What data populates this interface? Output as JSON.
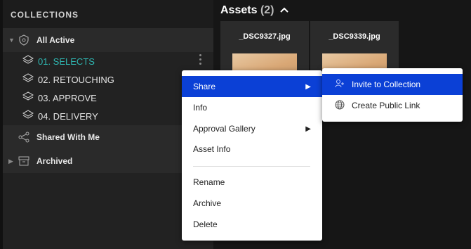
{
  "sidebar": {
    "header": "COLLECTIONS",
    "all_active": "All Active",
    "collections": [
      {
        "label": "01. SELECTS"
      },
      {
        "label": "02. RETOUCHING"
      },
      {
        "label": "03. APPROVE"
      },
      {
        "label": "04. DELIVERY"
      }
    ],
    "shared": "Shared With Me",
    "archived": "Archived"
  },
  "assets": {
    "title": "Assets",
    "count": "(2)",
    "cards": [
      {
        "name": "_DSC9327.jpg"
      },
      {
        "name": "_DSC9339.jpg"
      }
    ]
  },
  "context_menu": {
    "items": [
      "Share",
      "Info",
      "Approval Gallery",
      "Asset Info",
      "Rename",
      "Archive",
      "Delete"
    ]
  },
  "share_submenu": {
    "items": [
      "Invite to Collection",
      "Create Public Link"
    ]
  },
  "colors": {
    "accent": "#2fb8b3",
    "highlight": "#0b40d6"
  }
}
